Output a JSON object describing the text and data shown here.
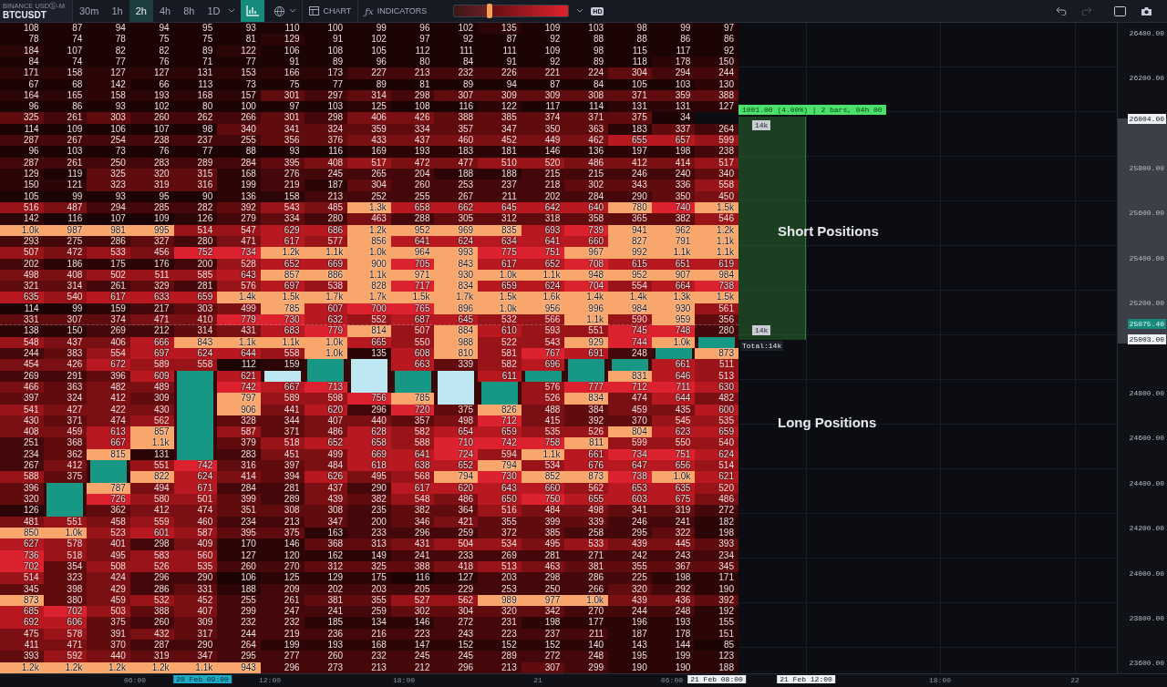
{
  "toolbar": {
    "exchange": "BINANCE USDⓈ-M",
    "symbol": "BTCUSDT",
    "timeframes": [
      {
        "label": "30m",
        "selected": false
      },
      {
        "label": "1h",
        "selected": false
      },
      {
        "label": "2h",
        "selected": true
      },
      {
        "label": "4h",
        "selected": false
      },
      {
        "label": "8h",
        "selected": false
      },
      {
        "label": "1D",
        "selected": false
      }
    ],
    "chart_button": "CHART",
    "indicators_icon": "ƒx",
    "indicators_button": "INDICATORS",
    "opacity_slider": {
      "level": 0.31
    },
    "hd_badge": "HD"
  },
  "heatmap": {
    "rows": [
      [
        "108",
        "87",
        "94",
        "94",
        "95",
        "93",
        "110",
        "100",
        "99",
        "96",
        "102",
        "135",
        "109",
        "103",
        "98",
        "99",
        "97"
      ],
      [
        "78",
        "74",
        "78",
        "75",
        "75",
        "81",
        "129",
        "91",
        "102",
        "97",
        "92",
        "87",
        "92",
        "88",
        "88",
        "86",
        "86"
      ],
      [
        "184",
        "107",
        "82",
        "82",
        "89",
        "122",
        "106",
        "108",
        "105",
        "112",
        "111",
        "111",
        "109",
        "98",
        "115",
        "117",
        "92"
      ],
      [
        "84",
        "74",
        "77",
        "76",
        "71",
        "77",
        "91",
        "89",
        "96",
        "80",
        "84",
        "91",
        "92",
        "89",
        "118",
        "178",
        "150"
      ],
      [
        "171",
        "158",
        "127",
        "127",
        "131",
        "153",
        "166",
        "173",
        "227",
        "213",
        "232",
        "226",
        "221",
        "224",
        "304",
        "294",
        "244"
      ],
      [
        "67",
        "68",
        "142",
        "66",
        "113",
        "73",
        "75",
        "77",
        "89",
        "81",
        "89",
        "94",
        "87",
        "84",
        "105",
        "103",
        "130"
      ],
      [
        "164",
        "165",
        "158",
        "193",
        "168",
        "157",
        "301",
        "297",
        "314",
        "298",
        "307",
        "309",
        "309",
        "308",
        "371",
        "359",
        "388"
      ],
      [
        "96",
        "86",
        "93",
        "102",
        "80",
        "100",
        "97",
        "103",
        "125",
        "108",
        "116",
        "122",
        "117",
        "114",
        "131",
        "131",
        "127"
      ],
      [
        "325",
        "261",
        "303",
        "260",
        "262",
        "266",
        "301",
        "298",
        "406",
        "426",
        "388",
        "385",
        "374",
        "371",
        "375",
        "34",
        null
      ],
      [
        "114",
        "109",
        "106",
        "107",
        "98",
        "340",
        "341",
        "324",
        "359",
        "334",
        "357",
        "347",
        "350",
        "363",
        "183",
        "337",
        "264"
      ],
      [
        "287",
        "267",
        "254",
        "238",
        "237",
        "255",
        "356",
        "376",
        "433",
        "437",
        "460",
        "452",
        "449",
        "462",
        "655",
        "657",
        "599"
      ],
      [
        "96",
        "103",
        "73",
        "76",
        "77",
        "88",
        "93",
        "116",
        "169",
        "193",
        "183",
        "181",
        "146",
        "136",
        "197",
        "198",
        "238"
      ],
      [
        "287",
        "261",
        "250",
        "283",
        "289",
        "284",
        "395",
        "408",
        "517",
        "472",
        "477",
        "510",
        "520",
        "486",
        "412",
        "414",
        "517"
      ],
      [
        "129",
        "119",
        "325",
        "320",
        "315",
        "168",
        "276",
        "245",
        "265",
        "204",
        "188",
        "188",
        "215",
        "215",
        "246",
        "240",
        "340"
      ],
      [
        "150",
        "121",
        "323",
        "319",
        "316",
        "199",
        "219",
        "187",
        "304",
        "260",
        "253",
        "237",
        "218",
        "302",
        "343",
        "336",
        "558"
      ],
      [
        "105",
        "99",
        "93",
        "95",
        "90",
        "136",
        "158",
        "213",
        "252",
        "255",
        "267",
        "211",
        "202",
        "284",
        "290",
        "350",
        "450"
      ],
      [
        "516",
        "487",
        "294",
        "285",
        "282",
        "392",
        "543",
        "485",
        "1.3k",
        "658",
        "662",
        "645",
        "642",
        "640",
        "780",
        "740",
        "1.5k"
      ],
      [
        "142",
        "116",
        "107",
        "109",
        "126",
        "279",
        "334",
        "280",
        "463",
        "288",
        "305",
        "312",
        "318",
        "358",
        "365",
        "382",
        "546"
      ],
      [
        "1.0k",
        "987",
        "981",
        "995",
        "514",
        "547",
        "629",
        "686",
        "1.2k",
        "952",
        "969",
        "835",
        "693",
        "739",
        "941",
        "962",
        "1.2k"
      ],
      [
        "293",
        "275",
        "286",
        "327",
        "280",
        "471",
        "617",
        "577",
        "856",
        "641",
        "624",
        "634",
        "641",
        "660",
        "827",
        "791",
        "1.1k"
      ],
      [
        "507",
        "472",
        "533",
        "456",
        "752",
        "734",
        "1.2k",
        "1.1k",
        "1.0k",
        "964",
        "993",
        "775",
        "751",
        "967",
        "992",
        "1.1k",
        "1.1k"
      ],
      [
        "202",
        "186",
        "175",
        "176",
        "200",
        "528",
        "652",
        "669",
        "900",
        "705",
        "843",
        "617",
        "652",
        "708",
        "615",
        "651",
        "619"
      ],
      [
        "498",
        "408",
        "502",
        "511",
        "585",
        "643",
        "857",
        "886",
        "1.1k",
        "971",
        "930",
        "1.0k",
        "1.1k",
        "948",
        "952",
        "907",
        "984"
      ],
      [
        "321",
        "314",
        "261",
        "329",
        "281",
        "576",
        "697",
        "538",
        "828",
        "717",
        "834",
        "659",
        "624",
        "704",
        "554",
        "664",
        "738"
      ],
      [
        "635",
        "540",
        "617",
        "633",
        "659",
        "1.4k",
        "1.5k",
        "1.7k",
        "1.7k",
        "1.5k",
        "1.7k",
        "1.5k",
        "1.6k",
        "1.4k",
        "1.4k",
        "1.3k",
        "1.5k"
      ],
      [
        "114",
        "99",
        "159",
        "217",
        "303",
        "499",
        "785",
        "607",
        "700",
        "765",
        "896",
        "1.0k",
        "956",
        "996",
        "984",
        "930",
        "561"
      ],
      [
        "331",
        "307",
        "374",
        "471",
        "410",
        "779",
        "730",
        "632",
        "552",
        "687",
        "645",
        "532",
        "566",
        "1.1k",
        "590",
        "959",
        "356"
      ],
      [
        "138",
        "150",
        "269",
        "212",
        "314",
        "431",
        "683",
        "779",
        "814",
        "507",
        "884",
        "610",
        "593",
        "551",
        "745",
        "748",
        "280"
      ],
      [
        "548",
        "437",
        "406",
        "666",
        "843",
        "1.1k",
        "1.1k",
        "1.0k",
        "665",
        "550",
        "988",
        "522",
        "543",
        "929",
        "744",
        "1.0k",
        {
          "rising": true
        }
      ],
      [
        "244",
        "383",
        "554",
        "697",
        "624",
        "644",
        "558",
        "1.0k",
        "135",
        "608",
        "810",
        "581",
        "767",
        "691",
        "248",
        {
          "rising": true
        },
        "873"
      ],
      [
        "454",
        "426",
        "672",
        "589",
        "558",
        "112",
        "159",
        {
          "rising": true
        },
        {
          "rising": false
        },
        "663",
        "339",
        "582",
        "696",
        {
          "rising": true
        },
        {
          "rising": true
        },
        "661",
        "511"
      ],
      [
        "269",
        "291",
        "396",
        "609",
        {
          "rising": true
        },
        "621",
        {
          "rising": false
        },
        {
          "rising": true
        },
        {
          "rising": false
        },
        {
          "rising": true
        },
        {
          "rising": false
        },
        "611",
        {
          "rising": true
        },
        {
          "rising": true
        },
        "831",
        "646",
        "513"
      ],
      [
        "466",
        "363",
        "482",
        "489",
        {
          "rising": true
        },
        "742",
        "667",
        "713",
        {
          "rising": false
        },
        {
          "rising": true
        },
        {
          "rising": false
        },
        {
          "rising": true
        },
        "576",
        "777",
        "712",
        "711",
        "630"
      ],
      [
        "397",
        "324",
        "412",
        "309",
        {
          "rising": true
        },
        "797",
        "589",
        "598",
        "756",
        "785",
        {
          "rising": false
        },
        {
          "rising": true
        },
        "526",
        "834",
        "474",
        "644",
        "482"
      ],
      [
        "541",
        "427",
        "422",
        "430",
        {
          "rising": true
        },
        "906",
        "441",
        "620",
        "296",
        "720",
        "375",
        "826",
        "488",
        "384",
        "459",
        "435",
        "600"
      ],
      [
        "430",
        "371",
        "474",
        "562",
        {
          "rising": true
        },
        "328",
        "344",
        "407",
        "440",
        "357",
        "498",
        "712",
        "415",
        "392",
        "370",
        "545",
        "535"
      ],
      [
        "408",
        "459",
        "613",
        "857",
        {
          "rising": true
        },
        "587",
        "371",
        "486",
        "628",
        "582",
        "654",
        "659",
        "535",
        "526",
        "804",
        "623",
        "659"
      ],
      [
        "251",
        "368",
        "667",
        "1.1k",
        {
          "rising": true
        },
        "379",
        "518",
        "652",
        "658",
        "588",
        "710",
        "742",
        "758",
        "811",
        "599",
        "550",
        "540"
      ],
      [
        "234",
        "362",
        "815",
        "131",
        {
          "rising": true
        },
        "283",
        "451",
        "499",
        "669",
        "641",
        "724",
        "594",
        "1.1k",
        "661",
        "734",
        "751",
        "624"
      ],
      [
        "267",
        "412",
        {
          "rising": true
        },
        "551",
        "742",
        "316",
        "397",
        "484",
        "618",
        "638",
        "652",
        "794",
        "534",
        "676",
        "647",
        "656",
        "514"
      ],
      [
        "588",
        "375",
        {
          "rising": true
        },
        "822",
        "624",
        "414",
        "394",
        "626",
        "495",
        "568",
        "794",
        "730",
        "852",
        "873",
        "738",
        "1.0k",
        "621"
      ],
      [
        "396",
        {
          "rising": true
        },
        "787",
        "494",
        "671",
        "284",
        "281",
        "437",
        "290",
        "617",
        "620",
        "643",
        "660",
        "562",
        "653",
        "635",
        "520"
      ],
      [
        "320",
        {
          "rising": true
        },
        "726",
        "580",
        "501",
        "399",
        "289",
        "439",
        "382",
        "548",
        "486",
        "650",
        "750",
        "655",
        "603",
        "675",
        "486"
      ],
      [
        "126",
        {
          "rising": true
        },
        "362",
        "412",
        "474",
        "351",
        "308",
        "308",
        "235",
        "382",
        "364",
        "516",
        "484",
        "498",
        "341",
        "319",
        "272"
      ],
      [
        "481",
        "551",
        "458",
        "559",
        "460",
        "234",
        "213",
        "347",
        "200",
        "346",
        "421",
        "355",
        "399",
        "339",
        "246",
        "241",
        "182"
      ],
      [
        "850",
        "1.0k",
        "523",
        "601",
        "587",
        "395",
        "375",
        "163",
        "233",
        "296",
        "259",
        "372",
        "385",
        "258",
        "295",
        "322",
        "198"
      ],
      [
        "627",
        "578",
        "401",
        "298",
        "409",
        "170",
        "146",
        "368",
        "313",
        "431",
        "504",
        "534",
        "495",
        "533",
        "439",
        "445",
        "393"
      ],
      [
        "736",
        "518",
        "495",
        "583",
        "560",
        "127",
        "120",
        "162",
        "149",
        "241",
        "233",
        "269",
        "281",
        "271",
        "242",
        "243",
        "234"
      ],
      [
        "702",
        "354",
        "508",
        "526",
        "535",
        "260",
        "270",
        "312",
        "325",
        "388",
        "418",
        "513",
        "463",
        "381",
        "355",
        "367",
        "345"
      ],
      [
        "514",
        "323",
        "424",
        "296",
        "290",
        "106",
        "125",
        "129",
        "175",
        "116",
        "127",
        "203",
        "298",
        "286",
        "225",
        "198",
        "171"
      ],
      [
        "345",
        "398",
        "429",
        "286",
        "331",
        "188",
        "209",
        "202",
        "203",
        "205",
        "229",
        "253",
        "250",
        "266",
        "320",
        "292",
        "190"
      ],
      [
        "873",
        "380",
        "459",
        "532",
        "452",
        "255",
        "261",
        "381",
        "355",
        "527",
        "562",
        "989",
        "977",
        "1.0k",
        "439",
        "436",
        "392"
      ],
      [
        "685",
        "702",
        "503",
        "388",
        "407",
        "299",
        "247",
        "241",
        "259",
        "302",
        "304",
        "320",
        "342",
        "270",
        "244",
        "248",
        "192"
      ],
      [
        "692",
        "606",
        "375",
        "260",
        "309",
        "232",
        "232",
        "185",
        "134",
        "146",
        "272",
        "231",
        "198",
        "177",
        "196",
        "193",
        "155"
      ],
      [
        "475",
        "578",
        "391",
        "432",
        "317",
        "244",
        "219",
        "236",
        "216",
        "223",
        "243",
        "223",
        "237",
        "211",
        "187",
        "178",
        "151"
      ],
      [
        "411",
        "471",
        "370",
        "287",
        "290",
        "264",
        "199",
        "193",
        "168",
        "147",
        "152",
        "152",
        "152",
        "140",
        "143",
        "144",
        "85"
      ],
      [
        "393",
        "592",
        "440",
        "319",
        "347",
        "295",
        "277",
        "260",
        "232",
        "245",
        "245",
        "289",
        "272",
        "248",
        "195",
        "199",
        "123"
      ],
      [
        "1.2k",
        "1.2k",
        "1.2k",
        "1.2k",
        "1.1k",
        "943",
        "296",
        "273",
        "213",
        "212",
        "296",
        "213",
        "307",
        "299",
        "190",
        "190",
        "188"
      ]
    ]
  },
  "measure": {
    "label": "1001.00 (4.00%) | 2 bars, 04h 00",
    "top_volume": "14k",
    "bottom_volume": "14k",
    "total": "Total:14k"
  },
  "zones": [
    {
      "label": "Short Positions"
    },
    {
      "label": "Long Positions"
    }
  ],
  "price_axis": [
    {
      "label": "26400.00",
      "kind": "tick"
    },
    {
      "label": "26200.00",
      "kind": "tick"
    },
    {
      "label": "26004.00",
      "kind": "marker"
    },
    {
      "label": "25800.00",
      "kind": "tick"
    },
    {
      "label": "25600.00",
      "kind": "tick"
    },
    {
      "label": "25400.00",
      "kind": "tick"
    },
    {
      "label": "25200.00",
      "kind": "tick"
    },
    {
      "label": "25075.40",
      "kind": "current"
    },
    {
      "label": "25003.00",
      "kind": "marker"
    },
    {
      "label": "24800.00",
      "kind": "tick"
    },
    {
      "label": "24600.00",
      "kind": "tick"
    },
    {
      "label": "24400.00",
      "kind": "tick"
    },
    {
      "label": "24200.00",
      "kind": "tick"
    },
    {
      "label": "24000.00",
      "kind": "tick"
    },
    {
      "label": "23800.00",
      "kind": "tick"
    },
    {
      "label": "23600.00",
      "kind": "tick"
    }
  ],
  "time_axis": [
    {
      "label": "06:00",
      "kind": "tick"
    },
    {
      "label": "20 Feb 09:00",
      "kind": "cursor"
    },
    {
      "label": "12:00",
      "kind": "tick"
    },
    {
      "label": "18:00",
      "kind": "tick"
    },
    {
      "label": "21",
      "kind": "tick"
    },
    {
      "label": "06:00",
      "kind": "tick"
    },
    {
      "label": "21 Feb 08:00",
      "kind": "marker"
    },
    {
      "label": "21 Feb 12:00",
      "kind": "marker"
    },
    {
      "label": "18:00",
      "kind": "tick"
    },
    {
      "label": "22",
      "kind": "tick"
    }
  ]
}
